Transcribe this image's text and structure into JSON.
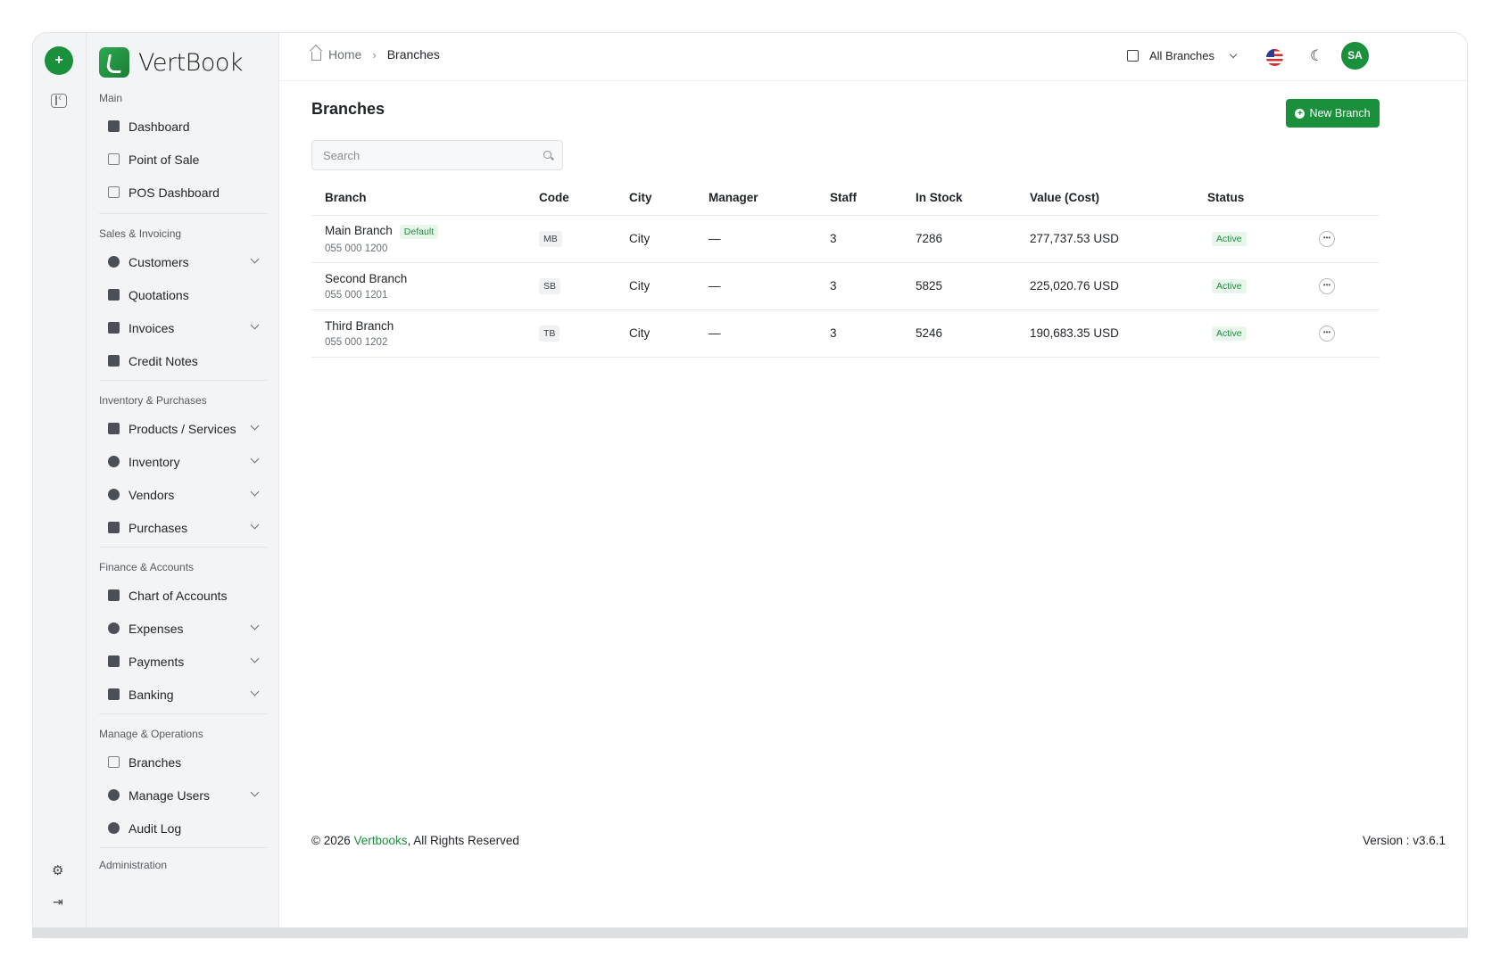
{
  "app": {
    "name": "VertBook"
  },
  "sidebar": {
    "sections": [
      {
        "title": "Main",
        "items": [
          {
            "label": "Dashboard",
            "icon": "dashboard-icon"
          },
          {
            "label": "Point of Sale",
            "icon": "store-icon"
          },
          {
            "label": "POS Dashboard",
            "icon": "chart-icon"
          }
        ]
      },
      {
        "title": "Sales & Invoicing",
        "items": [
          {
            "label": "Customers",
            "icon": "users-icon",
            "expandable": true
          },
          {
            "label": "Quotations",
            "icon": "quote-icon"
          },
          {
            "label": "Invoices",
            "icon": "invoice-icon",
            "expandable": true
          },
          {
            "label": "Credit Notes",
            "icon": "credit-note-icon"
          }
        ]
      },
      {
        "title": "Inventory & Purchases",
        "items": [
          {
            "label": "Products / Services",
            "icon": "box-icon",
            "expandable": true
          },
          {
            "label": "Inventory",
            "icon": "inventory-icon",
            "expandable": true
          },
          {
            "label": "Vendors",
            "icon": "vendors-icon",
            "expandable": true
          },
          {
            "label": "Purchases",
            "icon": "bag-icon",
            "expandable": true
          }
        ]
      },
      {
        "title": "Finance & Accounts",
        "items": [
          {
            "label": "Chart of Accounts",
            "icon": "ledger-icon"
          },
          {
            "label": "Expenses",
            "icon": "expense-icon",
            "expandable": true
          },
          {
            "label": "Payments",
            "icon": "payment-icon",
            "expandable": true
          },
          {
            "label": "Banking",
            "icon": "bank-icon",
            "expandable": true
          }
        ]
      },
      {
        "title": "Manage & Operations",
        "items": [
          {
            "label": "Branches",
            "icon": "store-icon"
          },
          {
            "label": "Manage Users",
            "icon": "users-icon",
            "expandable": true
          },
          {
            "label": "Audit Log",
            "icon": "audit-icon"
          }
        ]
      }
    ],
    "next_section_partial": "Administration"
  },
  "breadcrumb": {
    "home": "Home",
    "current": "Branches"
  },
  "topbar": {
    "branch_selector": "All Branches",
    "avatar_initials": "SA"
  },
  "page": {
    "title": "Branches",
    "new_button": "New Branch",
    "search_placeholder": "Search"
  },
  "table": {
    "headers": [
      "Branch",
      "Code",
      "City",
      "Manager",
      "Staff",
      "In Stock",
      "Value (Cost)",
      "Status"
    ],
    "rows": [
      {
        "name": "Main Branch",
        "badge": "Default",
        "phone": "055 000 1200",
        "code": "MB",
        "city": "City",
        "manager": "—",
        "staff": "3",
        "in_stock": "7286",
        "value": "277,737.53 USD",
        "status": "Active"
      },
      {
        "name": "Second Branch",
        "badge": "",
        "phone": "055 000 1201",
        "code": "SB",
        "city": "City",
        "manager": "—",
        "staff": "3",
        "in_stock": "5825",
        "value": "225,020.76 USD",
        "status": "Active"
      },
      {
        "name": "Third Branch",
        "badge": "",
        "phone": "055 000 1202",
        "code": "TB",
        "city": "City",
        "manager": "—",
        "staff": "3",
        "in_stock": "5246",
        "value": "190,683.35 USD",
        "status": "Active"
      }
    ]
  },
  "footer": {
    "prefix": "© 2026 ",
    "brand": "Vertbooks",
    "suffix": ", All Rights Reserved",
    "version": "Version : v3.6.1"
  },
  "colors": {
    "accent": "#1a8f3c",
    "accent_light": "#e9f6ec"
  }
}
